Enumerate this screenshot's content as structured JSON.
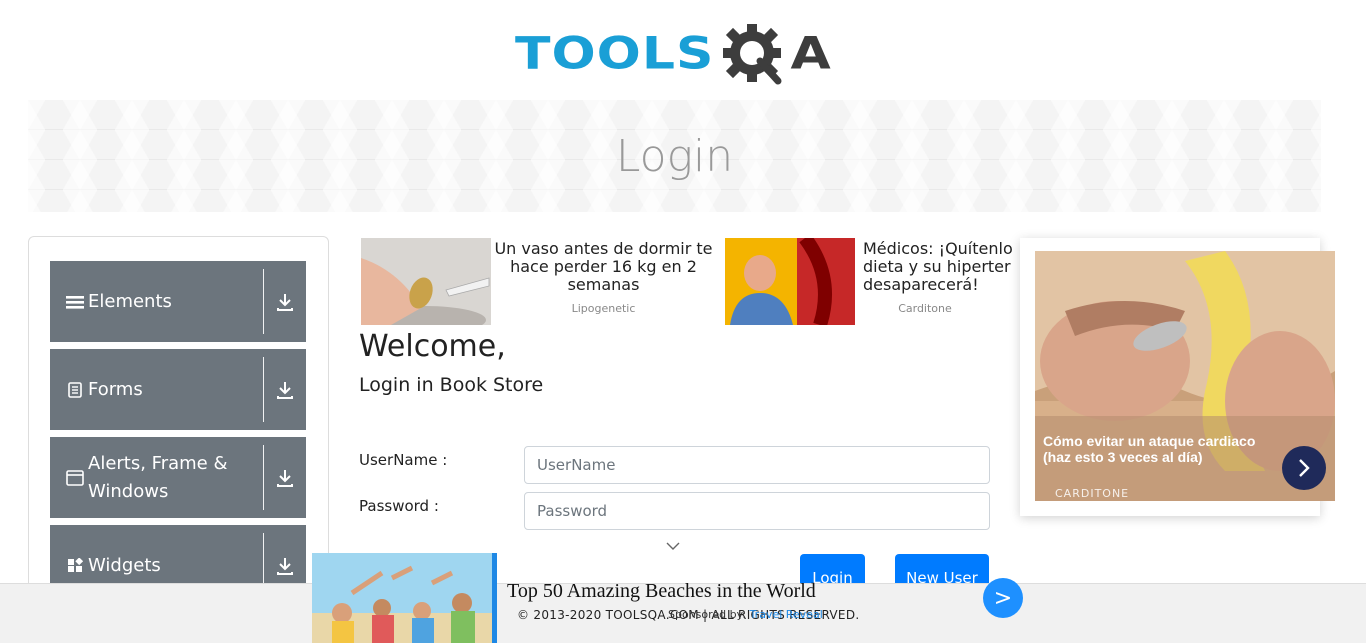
{
  "brand": {
    "tools": "TOOLS",
    "q": "Q",
    "a": "A"
  },
  "banner": {
    "title": "Login"
  },
  "sidebar": {
    "items": [
      {
        "label": "Elements",
        "icon": "menu-icon"
      },
      {
        "label": "Forms",
        "icon": "form-icon"
      },
      {
        "label": "Alerts, Frame & Windows",
        "icon": "window-icon"
      },
      {
        "label": "Widgets",
        "icon": "widgets-icon"
      }
    ]
  },
  "ads": [
    {
      "text": "Un vaso antes de dormir te hace perder 16 kg en 2 semanas",
      "source": "Lipogenetic"
    },
    {
      "text": "Médicos: ¡Quítenlo dieta y su hiperter desaparecerá!",
      "source": "Carditone"
    }
  ],
  "login": {
    "welcome": "Welcome,",
    "subtitle": "Login in Book Store",
    "username_label": "UserName :",
    "username_placeholder": "UserName",
    "password_label": "Password :",
    "password_placeholder": "Password",
    "login_button": "Login",
    "new_user_button": "New User"
  },
  "side_ad": {
    "caption": "Cómo evitar un ataque cardiaco (haz esto 3 veces al día)",
    "source": "CARDITONE"
  },
  "bottom_ad": {
    "title": "Top 50 Amazing Beaches in the World",
    "sponsored_prefix": "Sponsored by:",
    "sponsored_by": "Travel Reveal",
    "go": ">"
  },
  "footer": {
    "text": "© 2013-2020 TOOLSQA.COM | ALL RIGHTS RESERVED."
  },
  "colors": {
    "accent": "#007bff",
    "sidebar": "#6c757d",
    "brand_blue": "#1a9fd6"
  }
}
